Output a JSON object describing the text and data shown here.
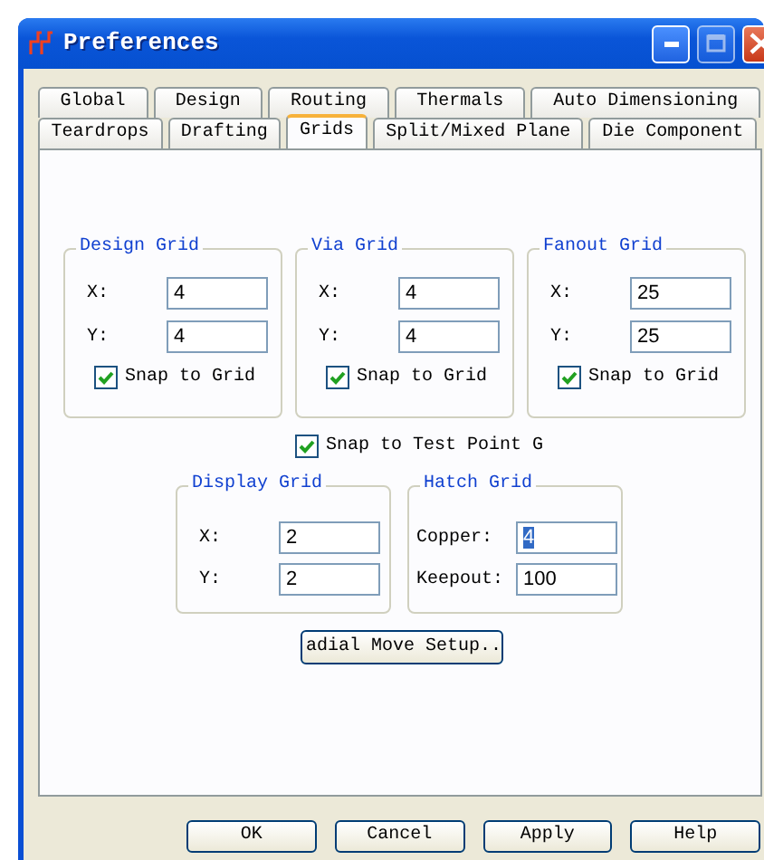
{
  "window": {
    "title": "Preferences"
  },
  "tab_rows": [
    {
      "tabs": [
        {
          "label": "Global",
          "selected": false
        },
        {
          "label": "Design",
          "selected": false
        },
        {
          "label": "Routing",
          "selected": false
        },
        {
          "label": "Thermals",
          "selected": false
        },
        {
          "label": "Auto Dimensioning",
          "selected": false
        }
      ]
    },
    {
      "tabs": [
        {
          "label": "Teardrops",
          "selected": false
        },
        {
          "label": "Drafting",
          "selected": false
        },
        {
          "label": "Grids",
          "selected": true
        },
        {
          "label": "Split/Mixed Plane",
          "selected": false
        },
        {
          "label": "Die Component",
          "selected": false
        }
      ]
    }
  ],
  "groups": [
    {
      "title": "Design Grid",
      "fields": [
        {
          "label": "X:",
          "value": "4"
        },
        {
          "label": "Y:",
          "value": "4"
        }
      ],
      "snap": {
        "label": "Snap to Grid",
        "checked": true
      }
    },
    {
      "title": "Via Grid",
      "fields": [
        {
          "label": "X:",
          "value": "4"
        },
        {
          "label": "Y:",
          "value": "4"
        }
      ],
      "snap": {
        "label": "Snap to Grid",
        "checked": true
      }
    },
    {
      "title": "Fanout Grid",
      "fields": [
        {
          "label": "X:",
          "value": "25"
        },
        {
          "label": "Y:",
          "value": "25"
        }
      ],
      "snap": {
        "label": "Snap to Grid",
        "checked": true
      }
    }
  ],
  "snap_test_point": {
    "label": "Snap to Test Point G",
    "checked": true
  },
  "lower_groups": [
    {
      "title": "Display Grid",
      "fields": [
        {
          "label": "X:",
          "value": "2",
          "highlighted": false
        },
        {
          "label": "Y:",
          "value": "2",
          "highlighted": false
        }
      ]
    },
    {
      "title": "Hatch Grid",
      "fields": [
        {
          "label": "Copper:",
          "value": "4",
          "highlighted": true
        },
        {
          "label": "Keepout:",
          "value": "100",
          "highlighted": false
        }
      ]
    }
  ],
  "setup_button": "adial Move Setup..",
  "buttons": [
    "OK",
    "Cancel",
    "Apply",
    "Help"
  ]
}
